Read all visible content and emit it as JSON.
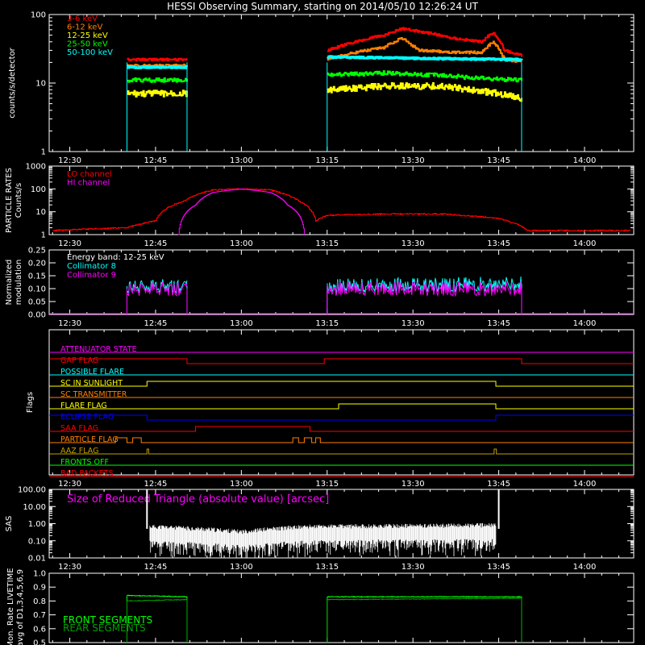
{
  "title": "HESSI Observing Summary, starting on 2014/05/10 12:26:24 UT",
  "time_ticks": [
    "12:30",
    "12:45",
    "13:00",
    "13:15",
    "13:30",
    "13:45",
    "14:00"
  ],
  "time_tick_minutes": [
    30,
    45,
    60,
    75,
    90,
    105,
    120
  ],
  "time_range_minutes": [
    26.4,
    128.6
  ],
  "colors": {
    "bg": "#000000",
    "axis": "#ffffff",
    "red": "#ff0000",
    "orange": "#ff8000",
    "yellow": "#ffff00",
    "green": "#00ff00",
    "cyan": "#00ffff",
    "magenta": "#ff00ff",
    "blue": "#0000ff",
    "olive": "#c0a000",
    "darkgreen": "#00a000"
  },
  "chart_data": [
    {
      "id": "count-rates",
      "type": "line",
      "ylabel": "counts/s/detector",
      "yscale": "log",
      "ylim": [
        1,
        100
      ],
      "yticks": [
        "1",
        "10",
        "100"
      ],
      "series": [
        {
          "name": "3-6 keV",
          "color": "#ff0000",
          "segments": [
            [
              [
                40,
                22
              ],
              [
                50.5,
                22
              ]
            ],
            [
              [
                75,
                30
              ],
              [
                80,
                40
              ],
              [
                85,
                50
              ],
              [
                88,
                62
              ],
              [
                92,
                55
              ],
              [
                97,
                45
              ],
              [
                102,
                40
              ],
              [
                104,
                55
              ],
              [
                106,
                30
              ],
              [
                109,
                25
              ]
            ]
          ]
        },
        {
          "name": "6-12 keV",
          "color": "#ff8000",
          "segments": [
            [
              [
                40,
                18
              ],
              [
                50.5,
                18
              ]
            ],
            [
              [
                75,
                22
              ],
              [
                80,
                28
              ],
              [
                85,
                33
              ],
              [
                88,
                45
              ],
              [
                91,
                30
              ],
              [
                97,
                28
              ],
              [
                102,
                28
              ],
              [
                104,
                40
              ],
              [
                106,
                22
              ],
              [
                109,
                20
              ]
            ]
          ]
        },
        {
          "name": "12-25 keV",
          "color": "#ffff00",
          "segments": [
            [
              [
                40,
                7
              ],
              [
                50.5,
                7
              ]
            ],
            [
              [
                75,
                8
              ],
              [
                85,
                9
              ],
              [
                95,
                9
              ],
              [
                100,
                8
              ],
              [
                105,
                7
              ],
              [
                109,
                6
              ]
            ]
          ]
        },
        {
          "name": "25-50 keV",
          "color": "#00ff00",
          "segments": [
            [
              [
                40,
                11
              ],
              [
                50.5,
                11
              ]
            ],
            [
              [
                75,
                13
              ],
              [
                85,
                14
              ],
              [
                95,
                13
              ],
              [
                100,
                12
              ],
              [
                109,
                11
              ]
            ]
          ]
        },
        {
          "name": "50-100 keV",
          "color": "#00ffff",
          "segments": [
            [
              [
                40,
                17
              ],
              [
                50.5,
                17
              ]
            ],
            [
              [
                75,
                24
              ],
              [
                90,
                23
              ],
              [
                109,
                22
              ]
            ]
          ]
        }
      ]
    },
    {
      "id": "particle-rates",
      "type": "line",
      "ylabel": "PARTICLE RATES Counts/s",
      "yscale": "log",
      "ylim": [
        1,
        1000
      ],
      "yticks": [
        "1",
        "10",
        "100",
        "1000"
      ],
      "series": [
        {
          "name": "LO channel",
          "color": "#ff0000",
          "segments": [
            [
              [
                27,
                1.5
              ],
              [
                40,
                2
              ],
              [
                45,
                4
              ],
              [
                50,
                30
              ],
              [
                55,
                90
              ],
              [
                60,
                100
              ],
              [
                65,
                90
              ],
              [
                70,
                30
              ],
              [
                73,
                4
              ],
              [
                75,
                7
              ],
              [
                85,
                8
              ],
              [
                95,
                8
              ],
              [
                105,
                5
              ],
              [
                110,
                1.5
              ],
              [
                128,
                1.5
              ]
            ]
          ]
        },
        {
          "name": "HI channel",
          "color": "#ff00ff",
          "segments": [
            [
              [
                49,
                1
              ],
              [
                52,
                20
              ],
              [
                55,
                70
              ],
              [
                60,
                100
              ],
              [
                65,
                70
              ],
              [
                68,
                20
              ],
              [
                71,
                1
              ]
            ]
          ]
        }
      ]
    },
    {
      "id": "modulation",
      "type": "line",
      "ylabel": "Normalized modulation",
      "ylim": [
        0,
        0.25
      ],
      "yticks": [
        "0.00",
        "0.05",
        "0.10",
        "0.15",
        "0.20",
        "0.25"
      ],
      "annotation": "Energy band: 12-25 keV",
      "series": [
        {
          "name": "Collimator 8",
          "color": "#00ffff",
          "segments": [
            [
              [
                40,
                0.11
              ],
              [
                50.5,
                0.11
              ]
            ],
            [
              [
                75,
                0.11
              ],
              [
                109,
                0.12
              ]
            ]
          ]
        },
        {
          "name": "Collimator 9",
          "color": "#ff00ff",
          "segments": [
            [
              [
                40,
                0.1
              ],
              [
                50.5,
                0.1
              ]
            ],
            [
              [
                75,
                0.1
              ],
              [
                109,
                0.1
              ]
            ]
          ]
        }
      ]
    },
    {
      "id": "flags",
      "type": "line",
      "ylabel": "Flags",
      "series": [
        {
          "name": "ATTENUATOR STATE",
          "color": "#ff00ff"
        },
        {
          "name": "GAP FLAG",
          "color": "#ff0000"
        },
        {
          "name": "POSSIBLE FLARE",
          "color": "#00ffff"
        },
        {
          "name": "SC IN SUNLIGHT",
          "color": "#ffff00"
        },
        {
          "name": "SC TRANSMITTER",
          "color": "#ff8000"
        },
        {
          "name": "FLARE FLAG",
          "color": "#ffff00"
        },
        {
          "name": "ECLIPSE FLAG",
          "color": "#0000ff"
        },
        {
          "name": "SAA FLAG",
          "color": "#ff0000"
        },
        {
          "name": "PARTICLE FLAG",
          "color": "#ff8000"
        },
        {
          "name": "AAZ FLAG",
          "color": "#c0a000"
        },
        {
          "name": "FRONTS OFF",
          "color": "#00ff00"
        },
        {
          "name": "BAD PACKETS",
          "color": "#ff0000"
        }
      ]
    },
    {
      "id": "sas",
      "type": "line",
      "ylabel": "SAS",
      "yscale": "log",
      "ylim": [
        0.01,
        100
      ],
      "yticks": [
        "0.01",
        "0.10",
        "1.00",
        "10.00",
        "100.00"
      ],
      "annotation": "Size of Reduced Triangle (absolute value) [arcsec]",
      "series": [
        {
          "color": "#ffffff",
          "segments": [
            [
              [
                43.5,
                100
              ],
              [
                44,
                0.5
              ],
              [
                60,
                0.25
              ],
              [
                72,
                0.5
              ],
              [
                90,
                0.55
              ],
              [
                104.5,
                0.6
              ],
              [
                105,
                100
              ]
            ]
          ]
        }
      ]
    },
    {
      "id": "livetime",
      "type": "line",
      "ylabel": "Mon. Rate LIVETIME avg of D1,3,4,5,6,9",
      "ylim": [
        0.5,
        1.0
      ],
      "yticks": [
        "0.5",
        "0.6",
        "0.7",
        "0.8",
        "0.9",
        "1.0"
      ],
      "series": [
        {
          "name": "FRONT SEGMENTS",
          "color": "#00ff00",
          "segments": [
            [
              [
                40,
                0.84
              ],
              [
                50.5,
                0.83
              ]
            ],
            [
              [
                75,
                0.83
              ],
              [
                109,
                0.83
              ]
            ]
          ]
        },
        {
          "name": "REAR SEGMENTS",
          "color": "#00a000",
          "segments": [
            [
              [
                40,
                0.8
              ],
              [
                50.5,
                0.81
              ]
            ],
            [
              [
                75,
                0.81
              ],
              [
                109,
                0.82
              ]
            ]
          ]
        }
      ]
    }
  ]
}
